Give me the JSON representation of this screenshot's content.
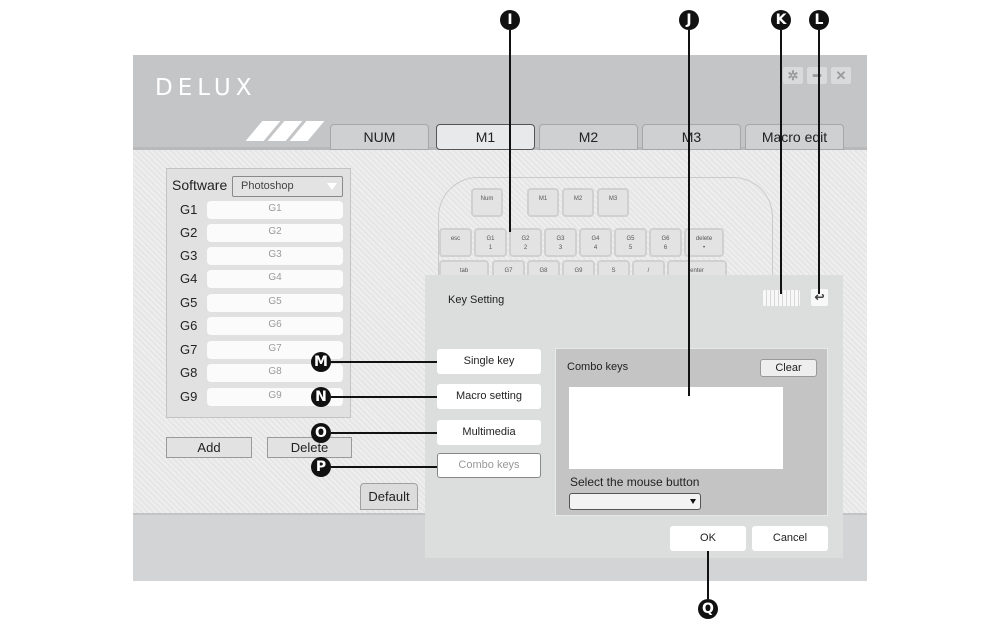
{
  "app": {
    "logo": "DELUX",
    "window_buttons": [
      {
        "icon": "gear-icon",
        "glyph": "✲"
      },
      {
        "icon": "minimize-icon",
        "glyph": "━"
      },
      {
        "icon": "close-icon",
        "glyph": "✕"
      }
    ]
  },
  "tabs": [
    {
      "label": "NUM",
      "active": false
    },
    {
      "label": "M1",
      "active": true
    },
    {
      "label": "M2",
      "active": false
    },
    {
      "label": "M3",
      "active": false
    },
    {
      "label": "Macro edit",
      "active": false
    }
  ],
  "side_panel": {
    "software_label": "Software",
    "software_value": "Photoshop",
    "keys": [
      {
        "label": "G1",
        "value": "G1"
      },
      {
        "label": "G2",
        "value": "G2"
      },
      {
        "label": "G3",
        "value": "G3"
      },
      {
        "label": "G4",
        "value": "G4"
      },
      {
        "label": "G5",
        "value": "G5"
      },
      {
        "label": "G6",
        "value": "G6"
      },
      {
        "label": "G7",
        "value": "G7"
      },
      {
        "label": "G8",
        "value": "G8"
      },
      {
        "label": "G9",
        "value": "G9"
      }
    ],
    "add_label": "Add",
    "delete_label": "Delete",
    "default_label": "Default"
  },
  "keyboard": {
    "row0": [
      {
        "top": "Num",
        "bottom": ""
      },
      {
        "top": "M1",
        "bottom": ""
      },
      {
        "top": "M2",
        "bottom": ""
      },
      {
        "top": "M3",
        "bottom": ""
      }
    ],
    "row1": [
      {
        "top": "esc",
        "bottom": ""
      },
      {
        "top": "G1",
        "bottom": "1"
      },
      {
        "top": "G2",
        "bottom": "2"
      },
      {
        "top": "G3",
        "bottom": "3"
      },
      {
        "top": "G4",
        "bottom": "4"
      },
      {
        "top": "G5",
        "bottom": "5"
      },
      {
        "top": "G6",
        "bottom": "6"
      },
      {
        "top": "delete",
        "bottom": "•"
      }
    ],
    "row2": [
      {
        "top": "tab",
        "bottom": ""
      },
      {
        "top": "G7",
        "bottom": ""
      },
      {
        "top": "G8",
        "bottom": ""
      },
      {
        "top": "G9",
        "bottom": ""
      },
      {
        "top": "S",
        "bottom": ""
      },
      {
        "top": "/",
        "bottom": ""
      },
      {
        "top": "enter",
        "bottom": ""
      }
    ]
  },
  "dialog": {
    "title": "Key Setting",
    "keyboard_icon": "keyboard-icon",
    "undo_icon": "undo-icon",
    "undo_glyph": "↩",
    "modes": [
      {
        "label": "Single key",
        "selected": false
      },
      {
        "label": "Macro setting",
        "selected": false
      },
      {
        "label": "Multimedia",
        "selected": false
      },
      {
        "label": "Combo keys",
        "selected": true
      }
    ],
    "combo_title": "Combo keys",
    "clear_label": "Clear",
    "combo_value": "",
    "mouse_label": "Select the mouse button",
    "mouse_value": "",
    "ok_label": "OK",
    "cancel_label": "Cancel"
  },
  "callouts": [
    "I",
    "J",
    "K",
    "L",
    "M",
    "N",
    "O",
    "P",
    "Q"
  ]
}
